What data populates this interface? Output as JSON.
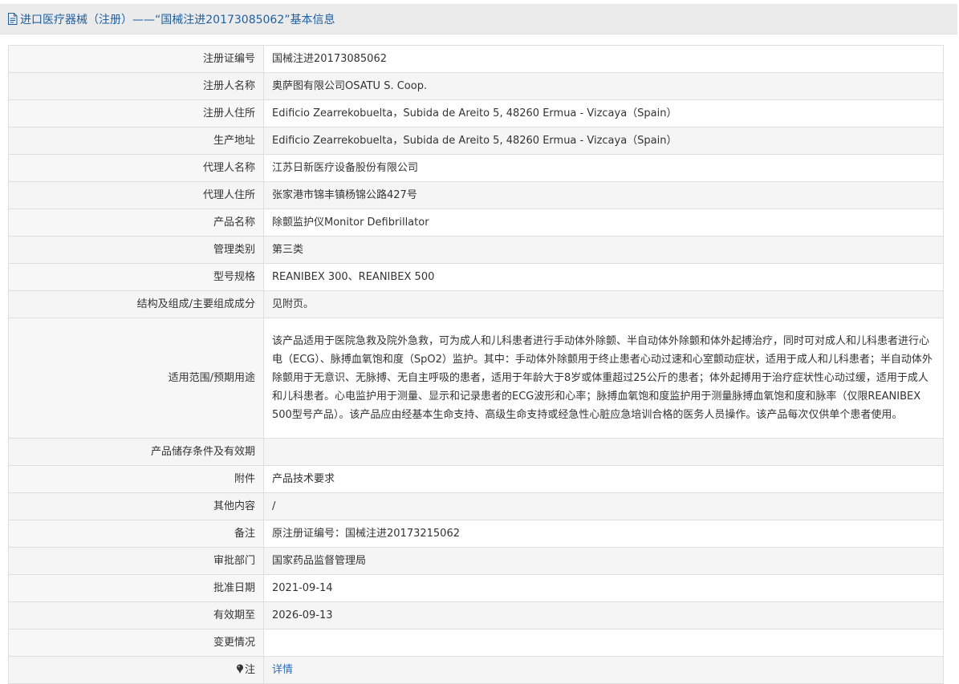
{
  "header": {
    "title": "进口医疗器械（注册）——“国械注进20173085062”基本信息"
  },
  "rows": [
    {
      "label": "注册证编号",
      "value": "国械注进20173085062"
    },
    {
      "label": "注册人名称",
      "value": "奥萨图有限公司OSATU S. Coop."
    },
    {
      "label": "注册人住所",
      "value": "Edificio Zearrekobuelta，Subida de Areito 5, 48260 Ermua - Vizcaya（Spain）"
    },
    {
      "label": "生产地址",
      "value": "Edificio Zearrekobuelta，Subida de Areito 5, 48260 Ermua - Vizcaya（Spain）"
    },
    {
      "label": "代理人名称",
      "value": "江苏日新医疗设备股份有限公司"
    },
    {
      "label": "代理人住所",
      "value": "张家港市锦丰镇杨锦公路427号"
    },
    {
      "label": "产品名称",
      "value": "除颤监护仪Monitor Defibrillator"
    },
    {
      "label": "管理类别",
      "value": "第三类"
    },
    {
      "label": "型号规格",
      "value": "REANIBEX 300、REANIBEX 500"
    },
    {
      "label": "结构及组成/主要组成成分",
      "value": "见附页。"
    },
    {
      "label": "适用范围/预期用途",
      "value": "该产品适用于医院急救及院外急救，可为成人和儿科患者进行手动体外除颤、半自动体外除颤和体外起搏治疗，同时可对成人和儿科患者进行心电（ECG）、脉搏血氧饱和度（SpO2）监护。其中：手动体外除颤用于终止患者心动过速和心室颤动症状，适用于成人和儿科患者；半自动体外除颤用于无意识、无脉搏、无自主呼吸的患者，适用于年龄大于8岁或体重超过25公斤的患者；体外起搏用于治疗症状性心动过缓，适用于成人和儿科患者。心电监护用于测量、显示和记录患者的ECG波形和心率；脉搏血氧饱和度监护用于测量脉搏血氧饱和度和脉率（仅限REANIBEX 500型号产品）。该产品应由经基本生命支持、高级生命支持或经急性心脏应急培训合格的医务人员操作。该产品每次仅供单个患者使用。"
    },
    {
      "label": "产品储存条件及有效期",
      "value": ""
    },
    {
      "label": "附件",
      "value": "产品技术要求"
    },
    {
      "label": "其他内容",
      "value": "/"
    },
    {
      "label": "备注",
      "value": "原注册证编号：国械注进20173215062"
    },
    {
      "label": "审批部门",
      "value": "国家药品监督管理局"
    },
    {
      "label": "批准日期",
      "value": "2021-09-14"
    },
    {
      "label": "有效期至",
      "value": "2026-09-13"
    },
    {
      "label": "变更情况",
      "value": ""
    }
  ],
  "note_row": {
    "label": "注",
    "link_text": "详情",
    "icon": "pin-icon"
  },
  "colors": {
    "title": "#1f5f9e",
    "link": "#2a6eb8",
    "border": "#dedede"
  }
}
